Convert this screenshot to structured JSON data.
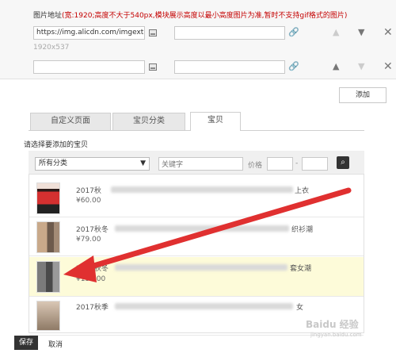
{
  "image_section": {
    "label": "图片地址",
    "hint": "(宽:1920;高度不大于540px,模块展示高度以最小高度图片为准,暂时不支持gif格式的图片)",
    "row1_url": "https://img.alicdn.com/imgext",
    "row1_link": "",
    "size_note": "1920x537",
    "row2_url": "",
    "row2_link": ""
  },
  "add_button": "添加",
  "tabs": [
    {
      "label": "自定义页面",
      "active": false
    },
    {
      "label": "宝贝分类",
      "active": false
    },
    {
      "label": "宝贝",
      "active": true
    }
  ],
  "choose_title": "请选择要添加的宝贝",
  "filter": {
    "category": "所有分类",
    "keyword_placeholder": "关键字",
    "price_label": "价格",
    "price_sep": "-"
  },
  "products": [
    {
      "name_prefix": "2017秋",
      "name_suffix": "上衣",
      "price": "¥60.00",
      "highlighted": false
    },
    {
      "name_prefix": "2017秋冬",
      "name_suffix": "织衫潮",
      "price": "¥79.00",
      "highlighted": false
    },
    {
      "name_prefix": "2017秋冬",
      "name_suffix": "套女潮",
      "price": "¥130.00",
      "highlighted": true
    },
    {
      "name_prefix": "2017秋季",
      "name_suffix": "女",
      "price": "",
      "highlighted": false
    }
  ],
  "footer": {
    "save": "保存",
    "cancel": "取消"
  },
  "watermark": {
    "logo": "Baidu 经验",
    "url": "jingyan.baidu.com"
  },
  "colors": {
    "hint_red": "#c40000",
    "highlight_row": "#fdfbd9",
    "arrow_red": "#e03030"
  }
}
